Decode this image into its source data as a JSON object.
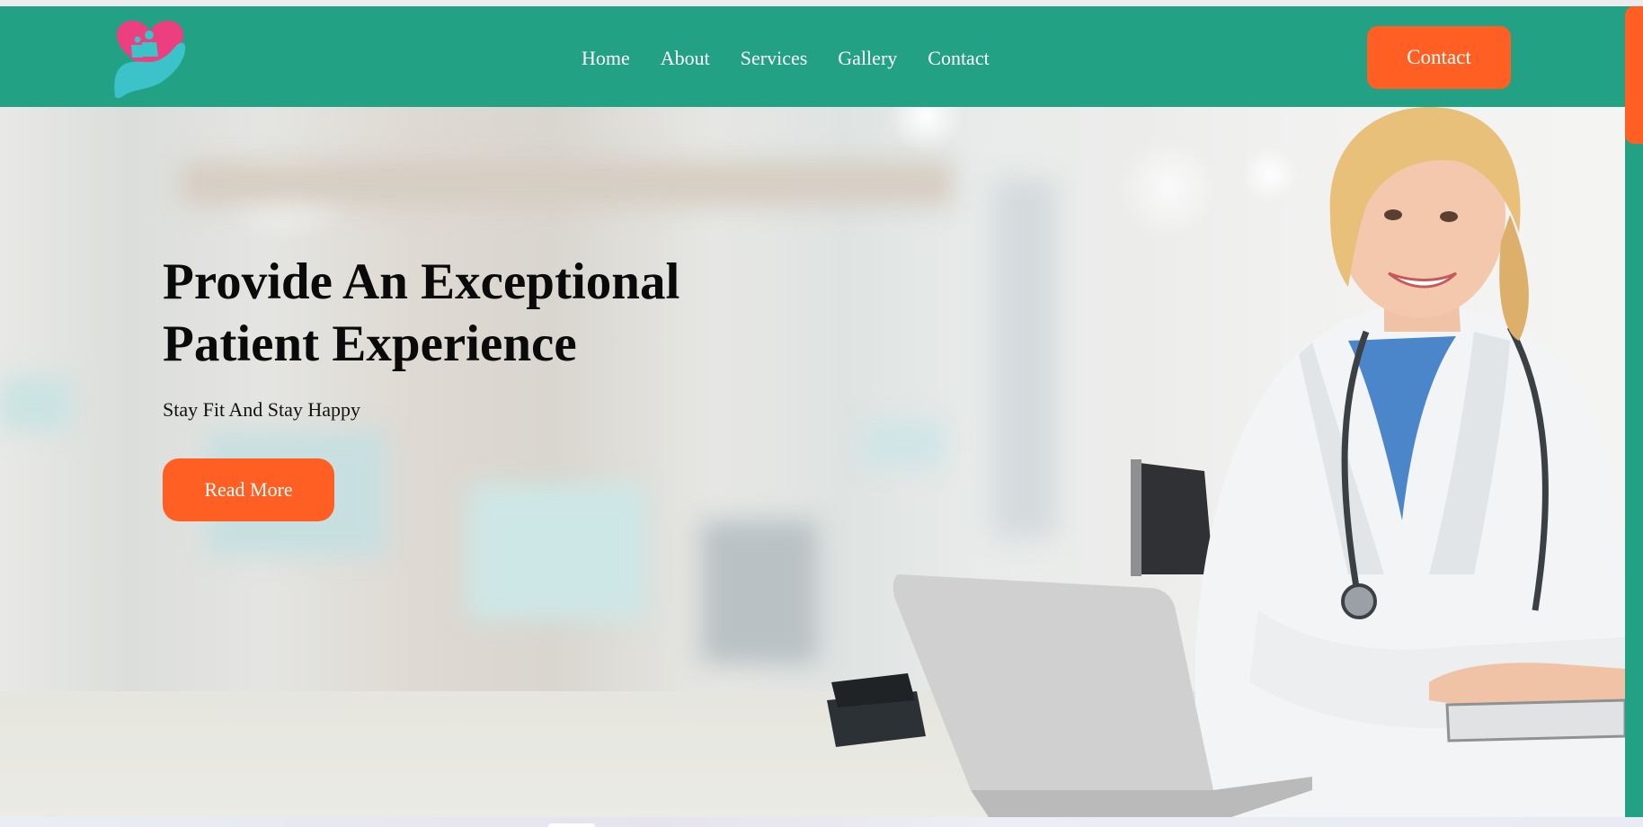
{
  "header": {
    "logo_icon": "heart-hand-logo-icon",
    "nav": [
      {
        "label": "Home"
      },
      {
        "label": "About"
      },
      {
        "label": "Services"
      },
      {
        "label": "Gallery"
      },
      {
        "label": "Contact"
      }
    ],
    "contact_button": "Contact"
  },
  "hero": {
    "title_line1": "Provide An Exceptional",
    "title_line2": "Patient Experience",
    "subtitle": "Stay Fit And Stay Happy",
    "read_more_button": "Read More",
    "image_icon": "doctor-with-laptop-photo"
  },
  "colors": {
    "brand_teal": "#22a185",
    "accent_orange": "#ff5f22",
    "logo_pink": "#ec3f7f",
    "logo_cyan": "#3cc2c9"
  }
}
